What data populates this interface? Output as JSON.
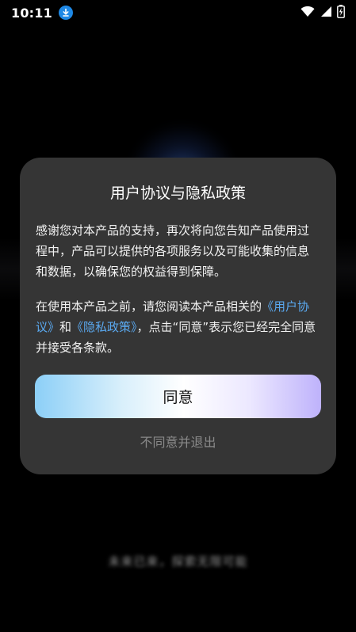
{
  "status_bar": {
    "time": "10:11",
    "icons": [
      "download-icon",
      "wifi-icon",
      "signal-icon",
      "battery-charging-icon"
    ]
  },
  "background": {
    "footer_text": "未来已来，探索无限可能"
  },
  "dialog": {
    "title": "用户协议与隐私政策",
    "paragraph1": "感谢您对本产品的支持，再次将向您告知产品使用过程中，产品可以提供的各项服务以及可能收集的信息和数据，以确保您的权益得到保障。",
    "paragraph2": {
      "prefix": "在使用本产品之前，请您阅读本产品相关的",
      "user_agreement_link": "《用户协议》",
      "and": "和",
      "privacy_policy_link": "《隐私政策》",
      "suffix": "，点击“同意”表示您已经完全同意并接受各条款。"
    },
    "agree_label": "同意",
    "disagree_label": "不同意并退出"
  },
  "colors": {
    "dialog_bg": "#353535",
    "link": "#5aa9f0",
    "disagree_text": "#8a8a8a"
  }
}
